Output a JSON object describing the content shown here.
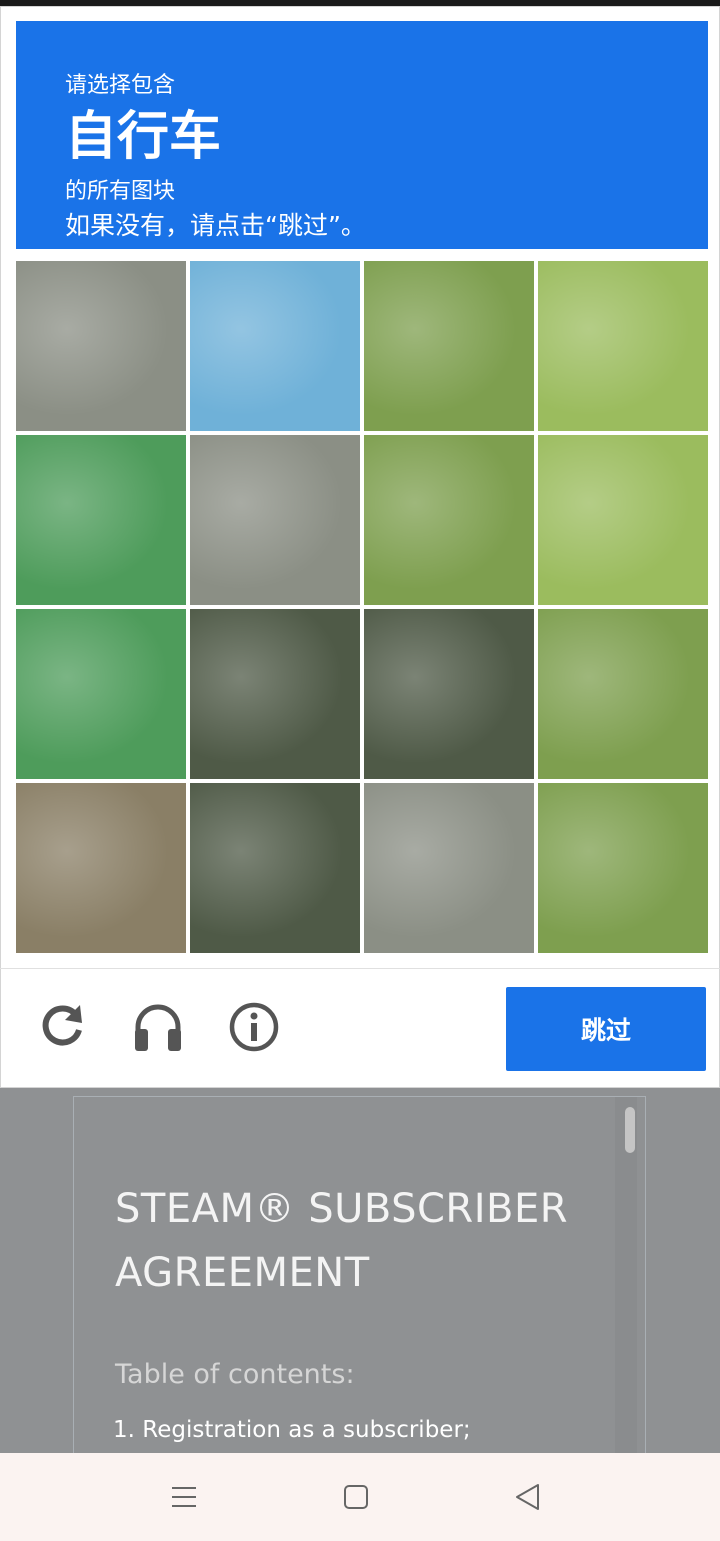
{
  "captcha": {
    "instruction_prefix": "请选择包含",
    "target_object": "自行车",
    "instruction_suffix": "的所有图块",
    "instruction_hint": "如果没有，请点击“跳过”。",
    "grid": {
      "rows": 4,
      "cols": 4,
      "selected": []
    },
    "controls": {
      "reload_icon": "reload-icon",
      "audio_icon": "headphones-icon",
      "info_icon": "info-icon",
      "skip_label": "跳过"
    },
    "colors": {
      "accent": "#1a73e8"
    }
  },
  "agreement": {
    "title": "STEAM® SUBSCRIBER AGREEMENT",
    "toc_label": "Table of contents:",
    "first_item": "1. Registration as a subscriber;"
  },
  "navbar": {
    "menu_icon": "menu-icon",
    "home_icon": "square-home-icon",
    "back_icon": "triangle-back-icon"
  }
}
